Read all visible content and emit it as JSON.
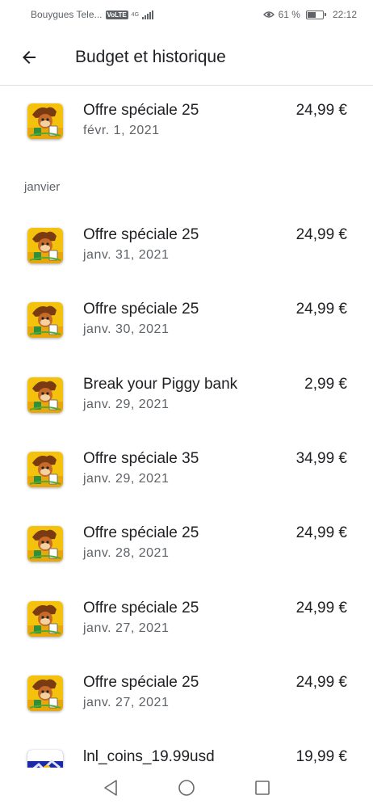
{
  "status_bar": {
    "carrier": "Bouygues Tele...",
    "volte": "VoLTE",
    "net_top": "4G",
    "net_bottom": "",
    "battery_percent": "61 %",
    "battery_level": 0.61,
    "time": "22:12"
  },
  "app_bar": {
    "title": "Budget et historique",
    "back_icon": "arrow-back-icon"
  },
  "transactions_top": [
    {
      "title": "Offre spéciale 25",
      "date": "févr. 1, 2021",
      "amount": "24,99 €",
      "icon": "game-app-icon"
    }
  ],
  "month_header": "janvier",
  "transactions_january": [
    {
      "title": "Offre spéciale 25",
      "date": "janv. 31, 2021",
      "amount": "24,99 €",
      "icon": "game-app-icon"
    },
    {
      "title": "Offre spéciale 25",
      "date": "janv. 30, 2021",
      "amount": "24,99 €",
      "icon": "game-app-icon"
    },
    {
      "title": "Break your Piggy bank",
      "date": "janv. 29, 2021",
      "amount": "2,99 €",
      "icon": "game-app-icon"
    },
    {
      "title": "Offre spéciale 35",
      "date": "janv. 29, 2021",
      "amount": "34,99 €",
      "icon": "game-app-icon"
    },
    {
      "title": "Offre spéciale 25",
      "date": "janv. 28, 2021",
      "amount": "24,99 €",
      "icon": "game-app-icon"
    },
    {
      "title": "Offre spéciale 25",
      "date": "janv. 27, 2021",
      "amount": "24,99 €",
      "icon": "game-app-icon"
    },
    {
      "title": "Offre spéciale 25",
      "date": "janv. 27, 2021",
      "amount": "24,99 €",
      "icon": "game-app-icon"
    },
    {
      "title": "lnl_coins_19.99usd",
      "date": "",
      "amount": "19,99 €",
      "icon": "coins-app-icon"
    }
  ],
  "nav_bar": {
    "back": "nav-back-icon",
    "home": "nav-home-icon",
    "recents": "nav-recents-icon"
  }
}
